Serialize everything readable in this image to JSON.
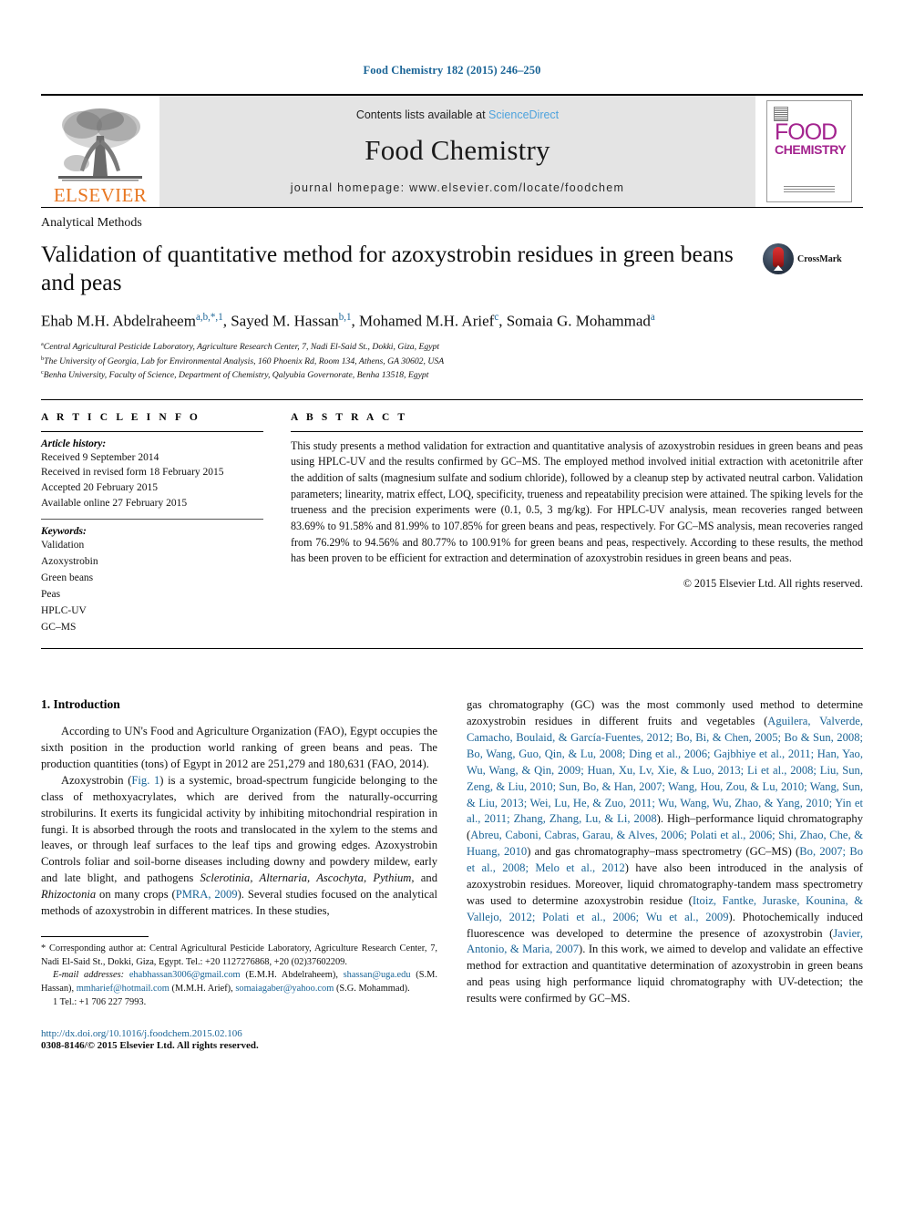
{
  "running_head": "Food Chemistry 182 (2015) 246–250",
  "masthead": {
    "publisher_name": "ELSEVIER",
    "contents_prefix": "Contents lists available at ",
    "sciencedirect": "ScienceDirect",
    "journal_title": "Food Chemistry",
    "homepage": "journal homepage: www.elsevier.com/locate/foodchem",
    "cover": {
      "line1": "FOOD",
      "line2": "CHEMISTRY"
    }
  },
  "article": {
    "section_label": "Analytical Methods",
    "title": "Validation of quantitative method for azoxystrobin residues in green beans and peas",
    "crossmark_label": "CrossMark",
    "authors": [
      {
        "name": "Ehab M.H. Abdelraheem",
        "marks": "a,b,*,1"
      },
      {
        "name": "Sayed M. Hassan",
        "marks": "b,1"
      },
      {
        "name": "Mohamed M.H. Arief",
        "marks": "c"
      },
      {
        "name": "Somaia G. Mohammad",
        "marks": "a"
      }
    ],
    "affiliations": [
      {
        "mark": "a",
        "text": "Central Agricultural Pesticide Laboratory, Agriculture Research Center, 7, Nadi El-Said St., Dokki, Giza, Egypt"
      },
      {
        "mark": "b",
        "text": "The University of Georgia, Lab for Environmental Analysis, 160 Phoenix Rd, Room 134, Athens, GA 30602, USA"
      },
      {
        "mark": "c",
        "text": "Benha University, Faculty of Science, Department of Chemistry, Qalyubia Governorate, Benha 13518, Egypt"
      }
    ]
  },
  "article_info": {
    "heading": "A R T I C L E   I N F O",
    "history_label": "Article history:",
    "history": [
      "Received 9 September 2014",
      "Received in revised form 18 February 2015",
      "Accepted 20 February 2015",
      "Available online 27 February 2015"
    ],
    "keywords_label": "Keywords:",
    "keywords": [
      "Validation",
      "Azoxystrobin",
      "Green beans",
      "Peas",
      "HPLC-UV",
      "GC–MS"
    ]
  },
  "abstract": {
    "heading": "A B S T R A C T",
    "text": "This study presents a method validation for extraction and quantitative analysis of azoxystrobin residues in green beans and peas using HPLC-UV and the results confirmed by GC–MS. The employed method involved initial extraction with acetonitrile after the addition of salts (magnesium sulfate and sodium chloride), followed by a cleanup step by activated neutral carbon. Validation parameters; linearity, matrix effect, LOQ, specificity, trueness and repeatability precision were attained. The spiking levels for the trueness and the precision experiments were (0.1, 0.5, 3 mg/kg). For HPLC-UV analysis, mean recoveries ranged between 83.69% to 91.58% and 81.99% to 107.85% for green beans and peas, respectively. For GC–MS analysis, mean recoveries ranged from 76.29% to 94.56% and 80.77% to 100.91% for green beans and peas, respectively. According to these results, the method has been proven to be efficient for extraction and determination of azoxystrobin residues in green beans and peas.",
    "copyright": "© 2015 Elsevier Ltd. All rights reserved."
  },
  "introduction": {
    "heading": "1. Introduction",
    "p1_a": "According to UN's Food and Agriculture Organization (FAO), Egypt occupies the sixth position in the production world ranking of green beans and peas. The production quantities (tons) of Egypt in 2012 are 251,279 and 180,631 (FAO, 2014).",
    "p2_a": "Azoxystrobin (",
    "p2_fig": "Fig. 1",
    "p2_b": ") is a systemic, broad-spectrum fungicide belonging to the class of methoxyacrylates, which are derived from the naturally-occurring strobilurins. It exerts its fungicidal activity by inhibiting mitochondrial respiration in fungi. It is absorbed through the roots and translocated in the xylem to the stems and leaves, or through leaf surfaces to the leaf tips and growing edges. Azoxystrobin Controls foliar and soil-borne diseases including downy and powdery mildew, early and late blight, and pathogens ",
    "p2_italics": "Sclerotinia, Alternaria, Ascochyta, Pythium,",
    "p2_c": " and ",
    "p2_italics2": "Rhizoctonia",
    "p2_d": " on many crops (",
    "p2_cite": "PMRA, 2009",
    "p2_e": "). Several studies focused on the analytical methods of azoxystrobin in different matrices. In these studies,",
    "r1_a": "gas chromatography (GC) was the most commonly used method to determine azoxystrobin residues in different fruits and vegetables (",
    "r1_cite1": "Aguilera, Valverde, Camacho, Boulaid, & García-Fuentes, 2012; Bo, Bi, & Chen, 2005; Bo & Sun, 2008; Bo, Wang, Guo, Qin, & Lu, 2008; Ding et al., 2006; Gajbhiye et al., 2011; Han, Yao, Wu, Wang, & Qin, 2009; Huan, Xu, Lv, Xie, & Luo, 2013; Li et al., 2008; Liu, Sun, Zeng, & Liu, 2010; Sun, Bo, & Han, 2007; Wang, Hou, Zou, & Lu, 2010; Wang, Sun, & Liu, 2013; Wei, Lu, He, & Zuo, 2011; Wu, Wang, Wu, Zhao, & Yang, 2010; Yin et al., 2011; Zhang, Zhang, Lu, & Li, 2008",
    "r1_b": "). High–performance liquid chromatography (",
    "r1_cite2": "Abreu, Caboni, Cabras, Garau, & Alves, 2006; Polati et al., 2006; Shi, Zhao, Che, & Huang, 2010",
    "r1_c": ") and gas chromatography–mass spectrometry (GC–MS) (",
    "r1_cite3": "Bo, 2007; Bo et al., 2008; Melo et al., 2012",
    "r1_d": ") have also been introduced in the analysis of azoxystrobin residues. Moreover, liquid chromatography-tandem mass spectrometry was used to determine azoxystrobin residue (",
    "r1_cite4": "Itoiz, Fantke, Juraske, Kounina, & Vallejo, 2012; Polati et al., 2006; Wu et al., 2009",
    "r1_e": "). Photochemically induced fluorescence was developed to determine the presence of azoxystrobin (",
    "r1_cite5": "Javier, Antonio, & Maria, 2007",
    "r1_f": "). In this work, we aimed to develop and validate an effective method for extraction and quantitative determination of azoxystrobin in green beans and peas using high performance liquid chromatography with UV-detection; the results were confirmed by GC–MS."
  },
  "footnotes": {
    "corresponding": "* Corresponding author at: Central Agricultural Pesticide Laboratory, Agriculture Research Center, 7, Nadi El-Said St., Dokki, Giza, Egypt. Tel.: +20 1127276868, +20 (02)37602209.",
    "email_label": "E-mail addresses:",
    "emails": [
      {
        "addr": "ehabhassan3006@gmail.com",
        "who": "(E.M.H. Abdelraheem)"
      },
      {
        "addr": "shassan@uga.edu",
        "who": "(S.M. Hassan)"
      },
      {
        "addr": "mmharief@hotmail.com",
        "who": "(M.M.H. Arief)"
      },
      {
        "addr": "somaiagaber@yahoo.com",
        "who": "(S.G. Mohammad)"
      }
    ],
    "tel_note": "1  Tel.: +1 706 227 7993.",
    "doi": "http://dx.doi.org/10.1016/j.foodchem.2015.02.106",
    "issn": "0308-8146/© 2015 Elsevier Ltd. All rights reserved."
  },
  "colors": {
    "link": "#1a6496",
    "elsevier_orange": "#e87722",
    "cover_magenta": "#a3238e",
    "banner_gray": "#e4e4e4"
  }
}
